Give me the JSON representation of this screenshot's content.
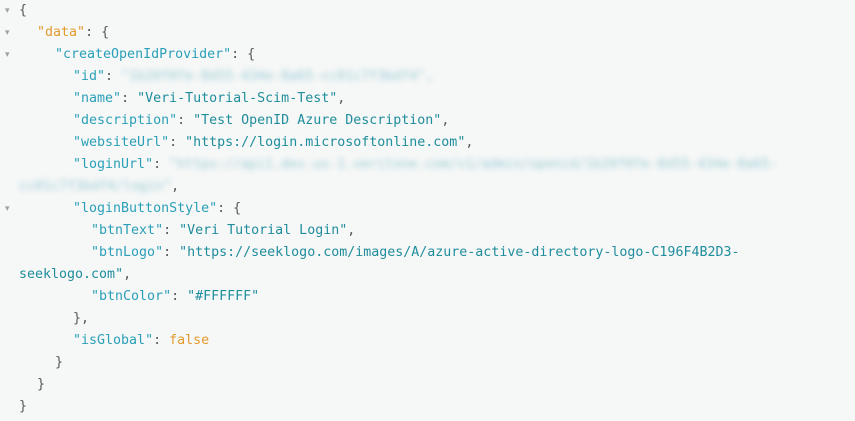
{
  "json": {
    "open_brace": "{",
    "close_brace": "}",
    "colon": ": ",
    "comma": ",",
    "quote": "\"",
    "root_key": "data",
    "mutation_key": "createOpenIdProvider",
    "fields": {
      "id": {
        "key": "id",
        "value": "1b20f0fe-8d55-434e-8a65-cc01c7f3bdf4"
      },
      "name": {
        "key": "name",
        "value": "Veri-Tutorial-Scim-Test"
      },
      "description": {
        "key": "description",
        "value": "Test OpenID Azure Description"
      },
      "websiteUrl": {
        "key": "websiteUrl",
        "value": "https://login.microsoftonline.com"
      },
      "loginUrl": {
        "key": "loginUrl",
        "value_part1": "https://api1.dev.us-1.veritone.com/v1/admin/openid/1b20f0fe-8d55-434e-8a65-",
        "value_part2": "cc01c7f3bdf4/login"
      },
      "loginButtonStyle": {
        "key": "loginButtonStyle",
        "btnText": {
          "key": "btnText",
          "value": "Veri Tutorial Login"
        },
        "btnLogo": {
          "key": "btnLogo",
          "value_part1": "https://seeklogo.com/images/A/azure-active-directory-logo-C196F4B2D3-",
          "value_part2": "seeklogo.com"
        },
        "btnColor": {
          "key": "btnColor",
          "value": "#FFFFFF"
        }
      },
      "isGlobal": {
        "key": "isGlobal",
        "value": "false"
      }
    }
  },
  "icons": {
    "collapse": "▾"
  },
  "colors": {
    "background": "#f6f7f7",
    "punctuation": "#555a5c",
    "top_key": "#e39a2c",
    "key": "#2aa0b8",
    "string": "#1f8d9c",
    "boolean": "#e39a2c"
  }
}
